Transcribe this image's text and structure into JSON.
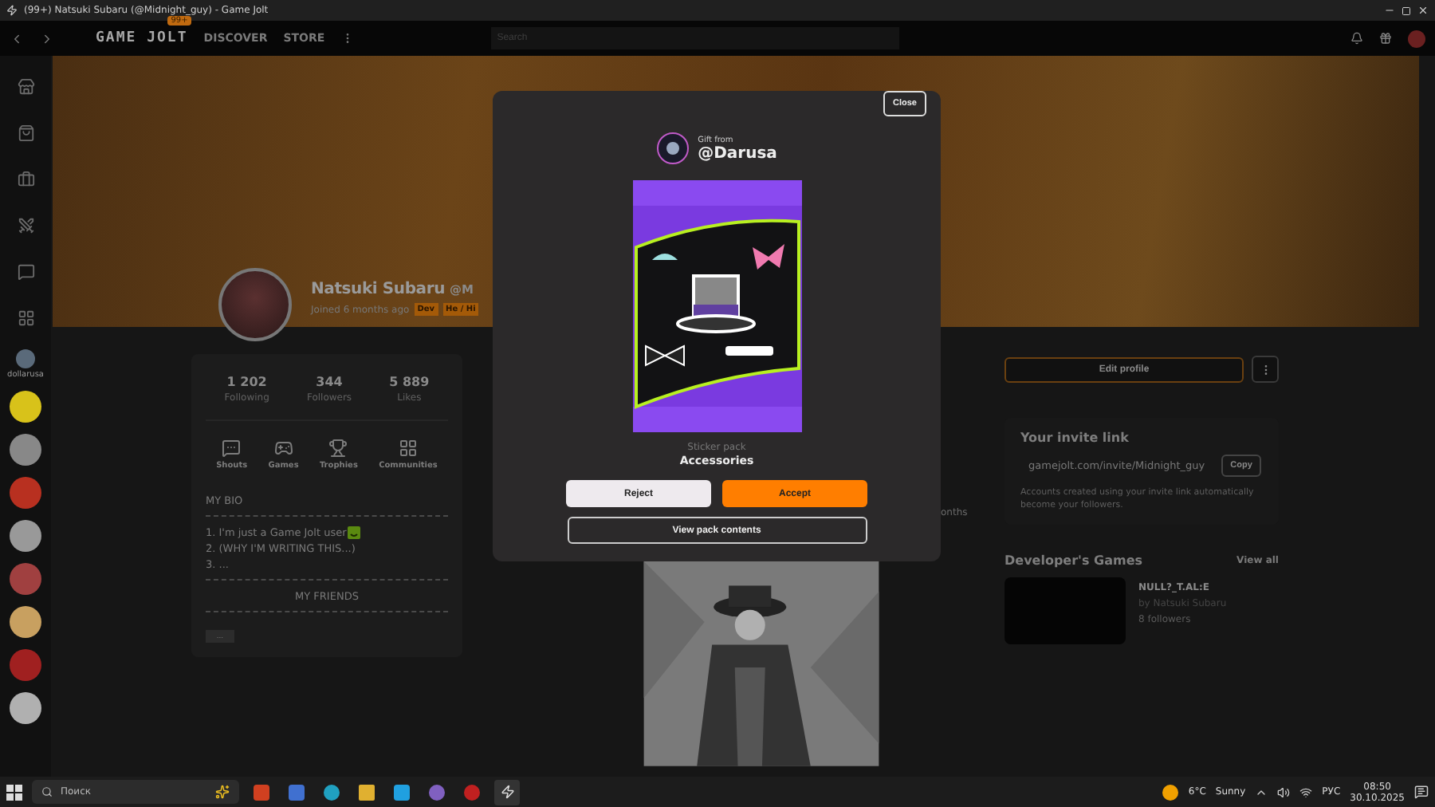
{
  "window": {
    "title": "(99+) Natsuki Subaru (@Midnight_guy) - Game Jolt"
  },
  "nav": {
    "logo": "GAME JOLT",
    "badge": "99+",
    "links": [
      "DISCOVER",
      "STORE"
    ],
    "search": {
      "placeholder": "Search"
    }
  },
  "sidebar": {
    "community_label": "dollarusa"
  },
  "profile": {
    "name": "Natsuki Subaru",
    "handle": "@M",
    "joined": "Joined 6 months ago",
    "tags": [
      "Dev",
      "He / Hi"
    ],
    "stats": [
      {
        "value": "1 202",
        "label": "Following"
      },
      {
        "value": "344",
        "label": "Followers"
      },
      {
        "value": "5 889",
        "label": "Likes"
      }
    ],
    "sections": [
      {
        "kind": "shouts",
        "label": "Shouts"
      },
      {
        "kind": "games",
        "label": "Games"
      },
      {
        "kind": "trophies",
        "label": "Trophies"
      },
      {
        "kind": "communities",
        "label": "Communities"
      }
    ],
    "bio": {
      "heading": "MY BIO",
      "lines": [
        "1. I'm just a Game Jolt user",
        "2. (WHY I'M WRITING THIS...)",
        "3. ..."
      ],
      "friends_heading": "MY FRIENDS",
      "more": "..."
    }
  },
  "feed": {
    "cut_text": "onths"
  },
  "side": {
    "edit_button": "Edit profile",
    "invite": {
      "title": "Your invite link",
      "link": "gamejolt.com/invite/Midnight_guy",
      "copy": "Copy",
      "note": "Accounts created using your invite link automatically become your followers."
    },
    "games": {
      "title": "Developer's Games",
      "view_all": "View all",
      "items": [
        {
          "name": "NULL?_T.AL:E",
          "by": "by Natsuki Subaru",
          "followers": "8 followers"
        }
      ]
    }
  },
  "gift": {
    "close": "Close",
    "from_label": "Gift from",
    "sender": "@Darusa",
    "pack_type": "Sticker pack",
    "pack_name": "Accessories",
    "reject": "Reject",
    "accept": "Accept",
    "view": "View pack contents"
  },
  "taskbar": {
    "search": "Поиск",
    "temp": "6°C",
    "weather": "Sunny",
    "lang": "РУС",
    "time": "08:50",
    "date": "30.10.2025"
  }
}
